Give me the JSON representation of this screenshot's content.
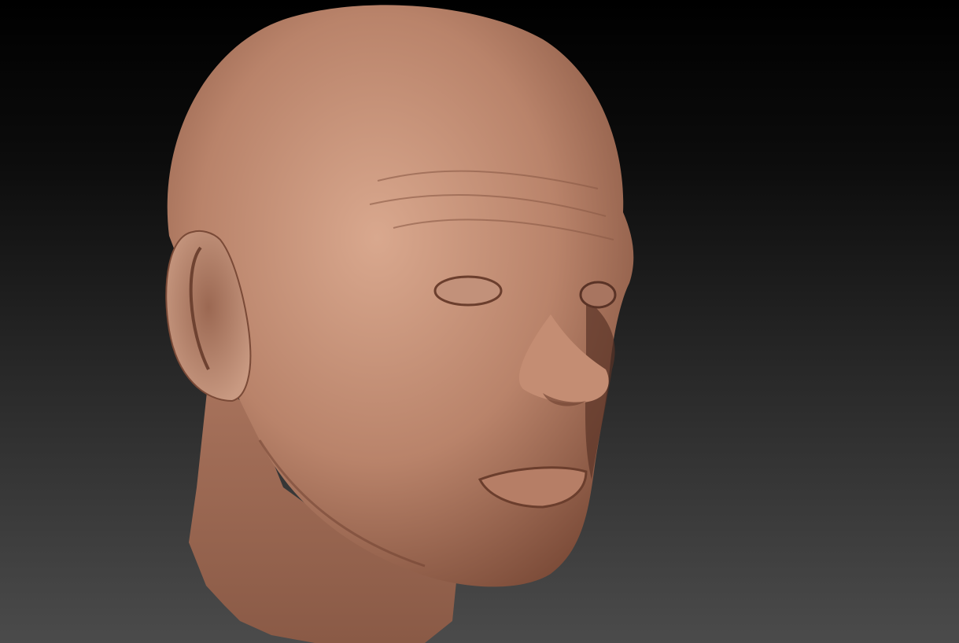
{
  "viewport": {
    "background_top": "#000000",
    "background_bottom": "#4b4b4b",
    "material_color": "#b07a62",
    "material_highlight": "#d6a58c",
    "material_shadow": "#5a3326"
  }
}
